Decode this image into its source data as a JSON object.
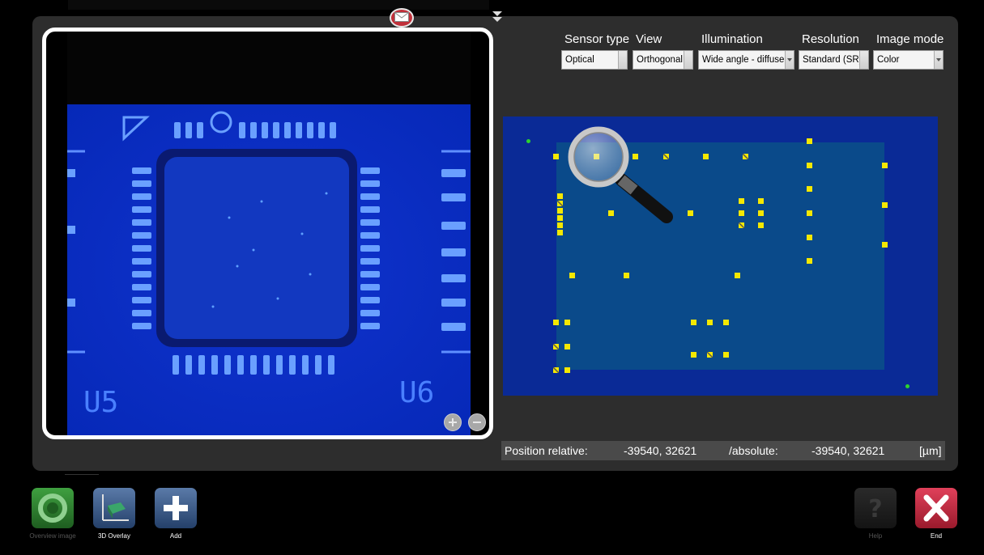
{
  "header": {
    "mail_icon": "envelope-icon",
    "down_arrow_icon": "double-chevron-down-icon"
  },
  "camera_view": {
    "image_description_icon": "camera-live-view",
    "silkscreen_labels": [
      "U5",
      "U6"
    ],
    "zoom_in_icon": "zoom-in-icon",
    "zoom_out_icon": "zoom-out-icon"
  },
  "settings": {
    "sensor_type": {
      "label": "Sensor type",
      "value": "Optical"
    },
    "view": {
      "label": "View",
      "value": "Orthogonal"
    },
    "illumination": {
      "label": "Illumination",
      "value": "Wide angle - diffuse"
    },
    "resolution": {
      "label": "Resolution",
      "value": "Standard (SR)"
    },
    "image_mode": {
      "label": "Image mode",
      "value": "Color"
    }
  },
  "board_map": {
    "magnifier_icon": "magnifier-icon",
    "colors": {
      "board": "#0a2a96",
      "inner": "#0a4a8a",
      "pad": "#f5e800",
      "fiducial": "#2dd42d"
    }
  },
  "position": {
    "relative_label": "Position relative:",
    "relative_value": "-39540, 32621",
    "absolute_label": "/absolute:",
    "absolute_value": "-39540, 32621",
    "unit": "[µm]"
  },
  "toolbar": {
    "overview_label": "Overview image",
    "overlay_label": "3D Overlay",
    "add_label": "Add",
    "help_label": "Help",
    "end_label": "End",
    "colors": {
      "overview": "#2e7d2e",
      "overlay": "#3a5a8a",
      "add": "#3a5a8a",
      "help": "#303030",
      "end": "#c8283c"
    }
  }
}
